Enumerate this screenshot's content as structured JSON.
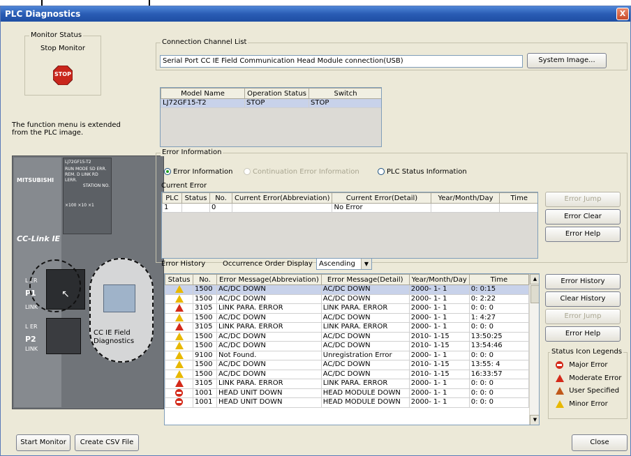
{
  "window": {
    "title": "PLC Diagnostics",
    "close_glyph": "X"
  },
  "monitor": {
    "group_label": "Monitor Status",
    "status": "Stop Monitor",
    "stop_icon_text": "STOP",
    "note": "The function menu is extended from the PLC image."
  },
  "plc_image": {
    "brand": "MITSUBISHI",
    "model": "LJ72GF15-T2",
    "led_row1": "RUN  MODE  SD  ERR.",
    "led_row2": "REM.  D LINK  RD  LERR.",
    "station_label": "STATION NO.",
    "multiplier": "×100 ×10 ×1",
    "cclink": "CC-Link IE",
    "port_p1": "P1",
    "port_p2": "P2",
    "ler": "L ER",
    "link": "LINK",
    "overlay_label": "CC IE Field Diagnostics"
  },
  "connection": {
    "group_label": "Connection Channel List",
    "value": "Serial Port CC IE Field Communication Head Module connection(USB)",
    "system_image_button": "System Image..."
  },
  "model_table": {
    "headers": [
      "Model Name",
      "Operation Status",
      "Switch"
    ],
    "rows": [
      [
        "LJ72GF15-T2",
        "STOP",
        "STOP"
      ]
    ]
  },
  "error_info": {
    "group_label": "Error Information",
    "radio_error": "Error Information",
    "radio_continuation": "Continuation Error Information",
    "radio_plc_status": "PLC Status Information",
    "current_error_label": "Current Error",
    "headers": [
      "PLC",
      "Status",
      "No.",
      "Current Error(Abbreviation)",
      "Current Error(Detail)",
      "Year/Month/Day",
      "Time"
    ],
    "rows": [
      [
        "1",
        "",
        "0",
        "",
        "No Error",
        "",
        ""
      ]
    ],
    "error_jump_button": "Error Jump",
    "error_clear_button": "Error Clear",
    "error_help_button": "Error Help"
  },
  "history": {
    "label": "Error History",
    "order_label": "Occurrence Order Display",
    "order_value": "Ascending",
    "headers": [
      "Status",
      "No.",
      "Error Message(Abbreviation)",
      "Error Message(Detail)",
      "Year/Month/Day",
      "Time"
    ],
    "rows": [
      {
        "icon": "warning-icon",
        "no": "1500",
        "abbr": "AC/DC DOWN",
        "detail": "AC/DC DOWN",
        "date": "2000- 1- 1",
        "time": "0: 0:15"
      },
      {
        "icon": "warning-icon",
        "no": "1500",
        "abbr": "AC/DC DOWN",
        "detail": "AC/DC DOWN",
        "date": "2000- 1- 1",
        "time": "0: 2:22"
      },
      {
        "icon": "moderate-error-icon",
        "no": "3105",
        "abbr": "LINK PARA. ERROR",
        "detail": "LINK PARA. ERROR",
        "date": "2000- 1- 1",
        "time": "0: 0: 0"
      },
      {
        "icon": "warning-icon",
        "no": "1500",
        "abbr": "AC/DC DOWN",
        "detail": "AC/DC DOWN",
        "date": "2000- 1- 1",
        "time": "1: 4:27"
      },
      {
        "icon": "moderate-error-icon",
        "no": "3105",
        "abbr": "LINK PARA. ERROR",
        "detail": "LINK PARA. ERROR",
        "date": "2000- 1- 1",
        "time": "0: 0: 0"
      },
      {
        "icon": "warning-icon",
        "no": "1500",
        "abbr": "AC/DC DOWN",
        "detail": "AC/DC DOWN",
        "date": "2010- 1-15",
        "time": "13:50:25"
      },
      {
        "icon": "warning-icon",
        "no": "1500",
        "abbr": "AC/DC DOWN",
        "detail": "AC/DC DOWN",
        "date": "2010- 1-15",
        "time": "13:54:46"
      },
      {
        "icon": "warning-icon",
        "no": "9100",
        "abbr": "Not Found.",
        "detail": "Unregistration Error",
        "date": "2000- 1- 1",
        "time": "0: 0: 0"
      },
      {
        "icon": "warning-icon",
        "no": "1500",
        "abbr": "AC/DC DOWN",
        "detail": "AC/DC DOWN",
        "date": "2010- 1-15",
        "time": "13:55: 4"
      },
      {
        "icon": "warning-icon",
        "no": "1500",
        "abbr": "AC/DC DOWN",
        "detail": "AC/DC DOWN",
        "date": "2010- 1-15",
        "time": "16:33:57"
      },
      {
        "icon": "moderate-error-icon",
        "no": "3105",
        "abbr": "LINK PARA. ERROR",
        "detail": "LINK PARA. ERROR",
        "date": "2000- 1- 1",
        "time": "0: 0: 0"
      },
      {
        "icon": "major-error-icon",
        "no": "1001",
        "abbr": "HEAD UNIT DOWN",
        "detail": "HEAD MODULE DOWN",
        "date": "2000- 1- 1",
        "time": "0: 0: 0"
      },
      {
        "icon": "major-error-icon",
        "no": "1001",
        "abbr": "HEAD UNIT DOWN",
        "detail": "HEAD MODULE DOWN",
        "date": "2000- 1- 1",
        "time": "0: 0: 0"
      }
    ],
    "error_history_button": "Error History",
    "clear_history_button": "Clear History",
    "error_jump_button": "Error Jump",
    "error_help_button": "Error Help"
  },
  "legend": {
    "group_label": "Status Icon Legends",
    "major": "Major Error",
    "moderate": "Moderate Error",
    "user": "User Specified",
    "minor": "Minor Error"
  },
  "footer": {
    "start_monitor": "Start Monitor",
    "create_csv": "Create CSV File",
    "close": "Close"
  }
}
